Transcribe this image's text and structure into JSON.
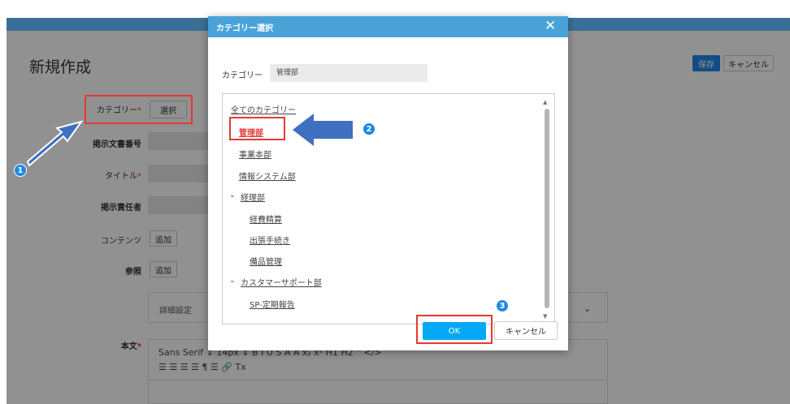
{
  "page": {
    "title": "新規作成",
    "save_label": "保存",
    "cancel_label": "キャンセル"
  },
  "form": {
    "category_label": "カテゴリー",
    "select_label": "選択",
    "doc_number_label": "掲示文書番号",
    "title_label": "タイトル",
    "owner_label": "掲示責任者",
    "contents_label": "コンテンツ",
    "reference_label": "参照",
    "add_label": "追加",
    "details_label": "詳細設定",
    "body_label": "本文",
    "required_mark": "*"
  },
  "editor": {
    "toolbar_row1": "Sans Serif ⇕ 14px ⇕ B I U S A A x₂ x² H1 H2 ” </>",
    "toolbar_row2": "☰ ☰ ☰ ☰ ¶ ☰ 🔗 Tx"
  },
  "dialog": {
    "title": "カテゴリー選択",
    "category_label": "カテゴリー",
    "category_value": "管理部",
    "tree": [
      {
        "label": "全てのカテゴリー"
      },
      {
        "label": "管理部",
        "selected": true
      },
      {
        "label": "事業本部"
      },
      {
        "label": "情報システム部"
      },
      {
        "label": "経理部",
        "expanded": true
      },
      {
        "label": "経費精算"
      },
      {
        "label": "出張手続き"
      },
      {
        "label": "備品管理"
      },
      {
        "label": "カスタマーサポート部",
        "expanded": true
      },
      {
        "label": "SP-定期報告"
      }
    ],
    "ok_label": "OK",
    "cancel_label": "キャンセル"
  },
  "steps": [
    "1",
    "2",
    "3"
  ],
  "colors": {
    "accent": "#1e88e5",
    "dialog_header": "#4aa3d8",
    "ok_button": "#03a9f4",
    "highlight": "#e53935",
    "arrow": "#3f6fc0"
  }
}
